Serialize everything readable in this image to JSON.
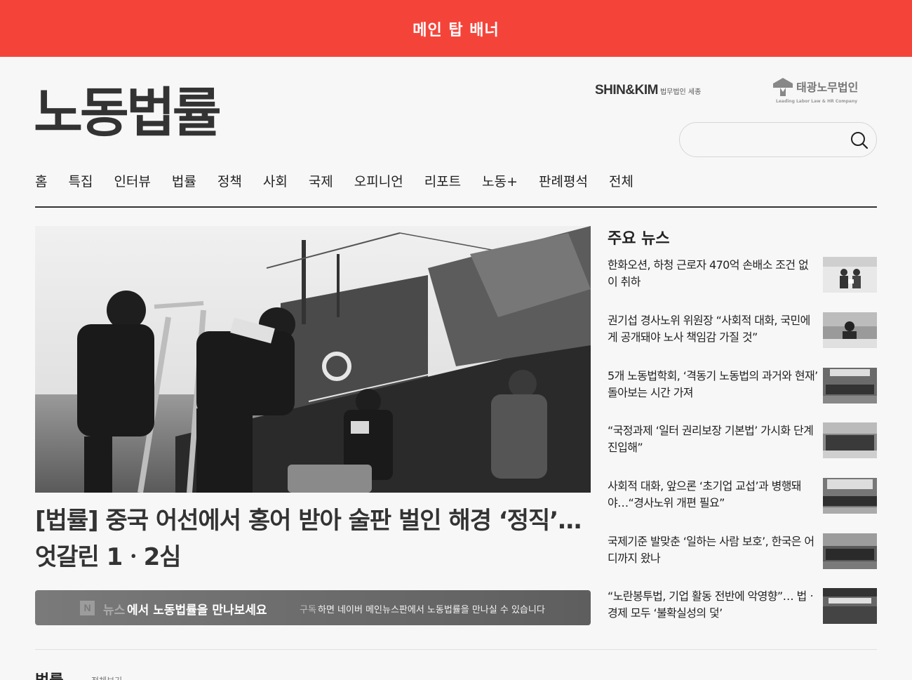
{
  "banner": {
    "text": "메인 탑 배너",
    "color": "#f4443a"
  },
  "logo": {
    "text": "노동법률"
  },
  "sponsors": [
    {
      "main": "SHIN&KIM",
      "sub": "법무법인 세종"
    },
    {
      "main": "태광노무법인",
      "sub": "Leading Labor Law & HR Company"
    }
  ],
  "search": {
    "placeholder": "",
    "icon": "search-icon"
  },
  "nav": [
    "홈",
    "특집",
    "인터뷰",
    "법률",
    "정책",
    "사회",
    "국제",
    "오피니언",
    "리포트",
    "노동+",
    "판례평석",
    "전체"
  ],
  "hero": {
    "image_alt": "해양경찰 POLICE",
    "title": "[법률] 중국 어선에서 홍어 받아 술판 벌인 해경 ‘정직’…엇갈린 1ㆍ2심"
  },
  "naver": {
    "logo": "N",
    "news_word": "뉴스",
    "headline": "에서 노동법률을 만나보세요",
    "sub_highlight": "구독",
    "sub_text": "하면 네이버 메인뉴스판에서 노동법률을 만나실 수 있습니다"
  },
  "top_news": {
    "title": "주요 뉴스",
    "items": [
      {
        "text": "한화오션, 하청 근로자 470억 손배소 조건 없이 취하"
      },
      {
        "text": "권기섭 경사노위 위원장 “사회적 대화, 국민에게 공개돼야 노사 책임감 가질 것”"
      },
      {
        "text": "5개 노동법학회, ‘격동기 노동법의 과거와 현재’ 돌아보는 시간 가져"
      },
      {
        "text": "“국정과제 ‘일터 권리보장 기본법’ 가시화 단계 진입해”"
      },
      {
        "text": "사회적 대화, 앞으론 ‘초기업 교섭’과 병행돼야…“경사노위 개편 필요”"
      },
      {
        "text": "국제기준 발맞춘 ‘일하는 사람 보호’, 한국은 어디까지 왔나"
      },
      {
        "text": "“노란봉투법, 기업 활동 전반에 악영향”… 법ㆍ경제 모두 ‘불확실성의 덫’"
      }
    ]
  },
  "section": {
    "title": "법률",
    "sub": "전체보기"
  }
}
